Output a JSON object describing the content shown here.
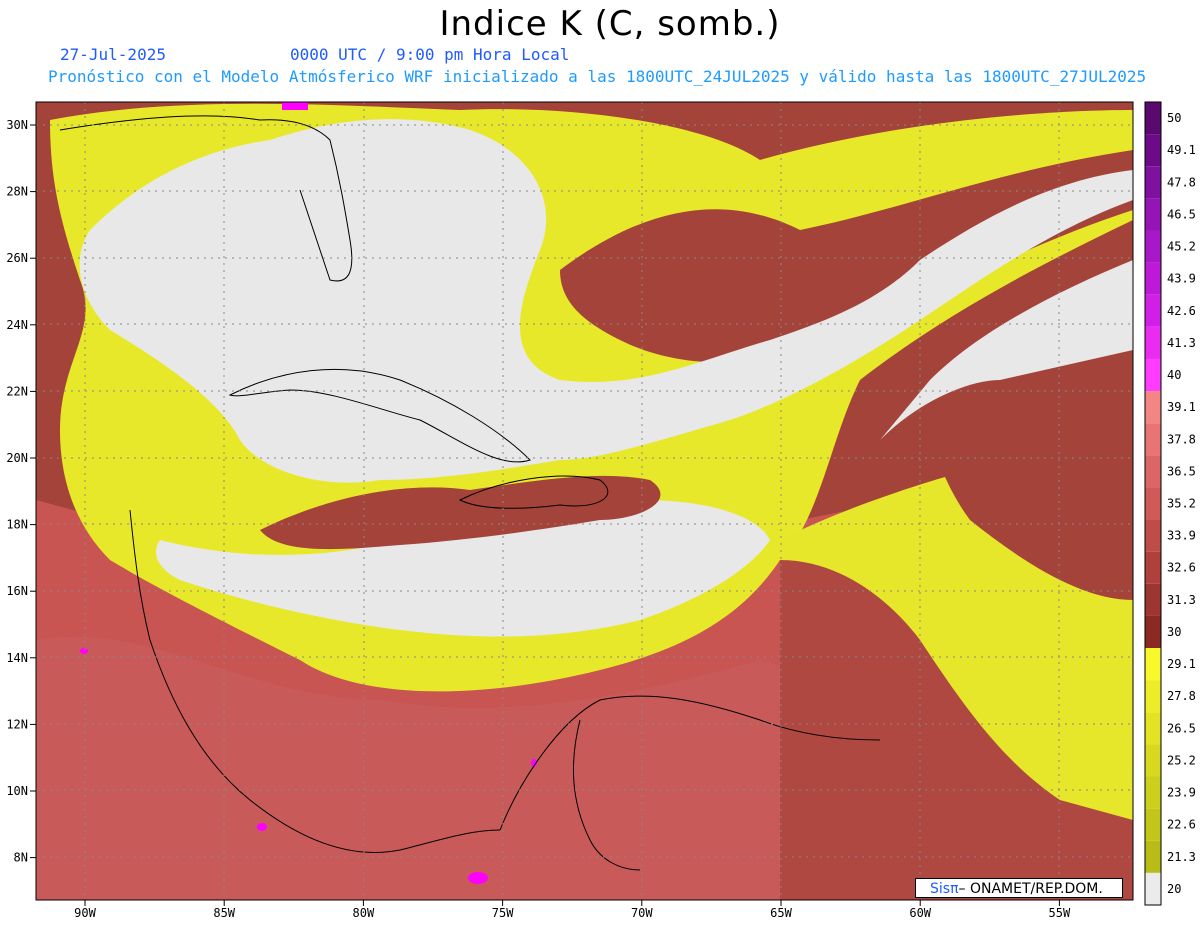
{
  "title": "Indice K (C, somb.)",
  "date": "27-Jul-2025",
  "time": "0000 UTC / 9:00 pm Hora Local",
  "forecast_line": "Pronóstico con el Modelo Atmósferico WRF inicializado a las 1800UTC_24JUL2025 y válido hasta las  1800UTC_27JUL2025",
  "credit": {
    "logo": "Sisπ",
    "text": " ONAMET/REP.DOM."
  },
  "lat_labels": [
    "30N",
    "28N",
    "26N",
    "24N",
    "22N",
    "20N",
    "18N",
    "16N",
    "14N",
    "12N",
    "10N",
    "8N"
  ],
  "lon_labels": [
    "90W",
    "85W",
    "80W",
    "75W",
    "70W",
    "65W",
    "60W",
    "55W"
  ],
  "colorbar": {
    "labels": [
      "50",
      "49.1",
      "47.8",
      "46.5",
      "45.2",
      "43.9",
      "42.6",
      "41.3",
      "40",
      "39.1",
      "37.8",
      "36.5",
      "35.2",
      "33.9",
      "32.6",
      "31.3",
      "30",
      "29.1",
      "27.8",
      "26.5",
      "25.2",
      "23.9",
      "22.6",
      "21.3",
      "20"
    ],
    "colors": [
      "#5a0a6e",
      "#6d0a87",
      "#80109f",
      "#9414b6",
      "#a817c8",
      "#bd1ad8",
      "#d21fe6",
      "#ea2bf0",
      "#ff3cff",
      "#f38585",
      "#e97474",
      "#dc6666",
      "#cf5a58",
      "#c04c49",
      "#b0403b",
      "#9d3530",
      "#8a2a22",
      "#f8f82a",
      "#ecec28",
      "#e3e323",
      "#d8d81f",
      "#ccd01c",
      "#c3c61a",
      "#b9bb17"
    ],
    "low_color": "#ebebeb"
  },
  "field_colors": {
    "gray": "#e7e7e7",
    "yellow": "#e9e92a",
    "brown": "#9a3a30",
    "red": "#d46060",
    "magenta": "#ff00ff"
  }
}
